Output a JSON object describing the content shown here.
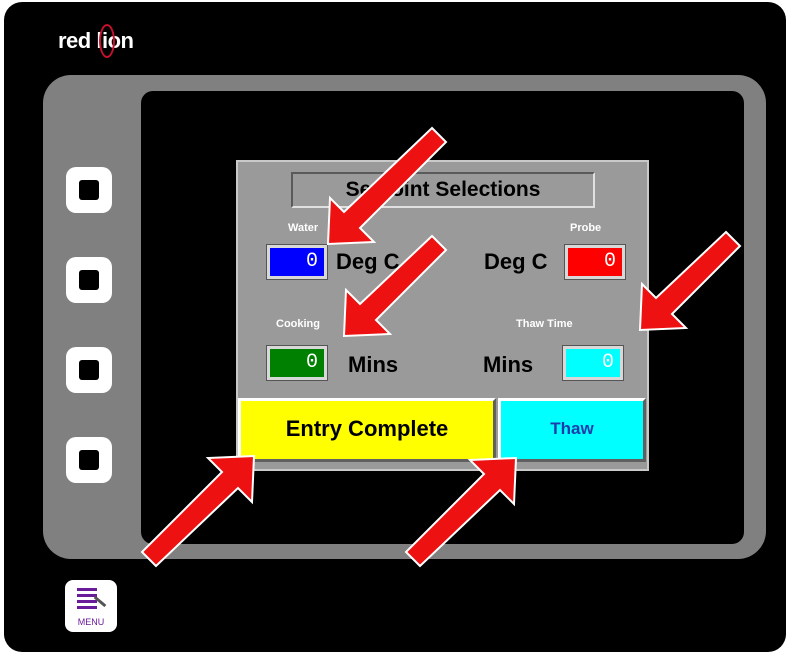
{
  "brand": {
    "logo_text_a": "red l",
    "logo_text_b": "on",
    "logo_o": "i"
  },
  "menu": {
    "label": "MENU",
    "icon": "menu-icon"
  },
  "panel": {
    "title": "Setpoint Selections",
    "water": {
      "label": "Water",
      "value": "0",
      "unit": "Deg C",
      "color": "#0000ff"
    },
    "probe": {
      "label": "Probe",
      "value": "0",
      "unit": "Deg C",
      "color": "#ff0000"
    },
    "cooking": {
      "label": "Cooking",
      "value": "0",
      "unit": "Mins",
      "color": "#008000"
    },
    "thaw_time": {
      "label": "Thaw Time",
      "value": "0",
      "unit": "Mins",
      "color": "#00ffff"
    }
  },
  "buttons": {
    "entry_complete": {
      "label": "Entry Complete",
      "color": "#ffff00"
    },
    "thaw": {
      "label": "Thaw",
      "color": "#00ffff"
    }
  }
}
